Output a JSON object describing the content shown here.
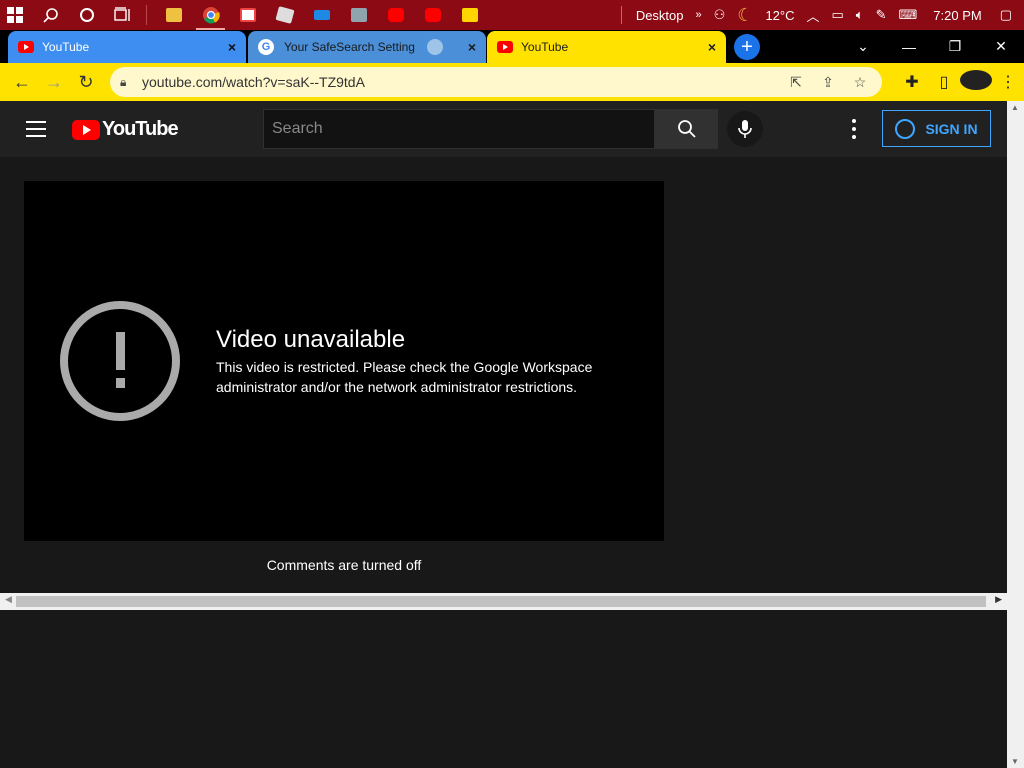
{
  "taskbar": {
    "desktop_label": "Desktop",
    "weather": "12°C",
    "time": "7:20 PM",
    "icons": [
      "windows-start-icon",
      "search-icon",
      "cortana-icon",
      "task-view-icon"
    ],
    "apps": [
      {
        "name": "file-explorer-icon",
        "color": "#f0c040"
      },
      {
        "name": "chrome-icon",
        "color": "#4caf50"
      },
      {
        "name": "store-icon",
        "color": "#ffffff"
      },
      {
        "name": "roblox-icon",
        "color": "#dddddd"
      },
      {
        "name": "monitor-app-icon",
        "color": "#1e88e5"
      },
      {
        "name": "photos-icon",
        "color": "#90a4ae"
      },
      {
        "name": "youtube-app-icon",
        "color": "#ff0000"
      },
      {
        "name": "youtube-app-icon-2",
        "color": "#ff0000"
      },
      {
        "name": "sticky-notes-icon",
        "color": "#ffd600"
      }
    ]
  },
  "tabs": [
    {
      "title": "YouTube",
      "close": "×"
    },
    {
      "title": "Your SafeSearch Setting",
      "close": "×"
    },
    {
      "title": "YouTube",
      "close": "×"
    }
  ],
  "new_tab": "+",
  "address": {
    "url": "youtube.com/watch?v=saK--TZ9tdA"
  },
  "youtube": {
    "logo_text": "YouTube",
    "search_placeholder": "Search",
    "sign_in": "SIGN IN"
  },
  "player": {
    "title": "Video unavailable",
    "message": "This video is restricted. Please check the Google Workspace administrator and/or the network administrator restrictions."
  },
  "comments": "Comments are turned off",
  "colors": {
    "taskbar": "#8b0a14",
    "chrome_theme": "#ffe200",
    "yt_red": "#ff0000",
    "signin_blue": "#3ea6ff"
  }
}
